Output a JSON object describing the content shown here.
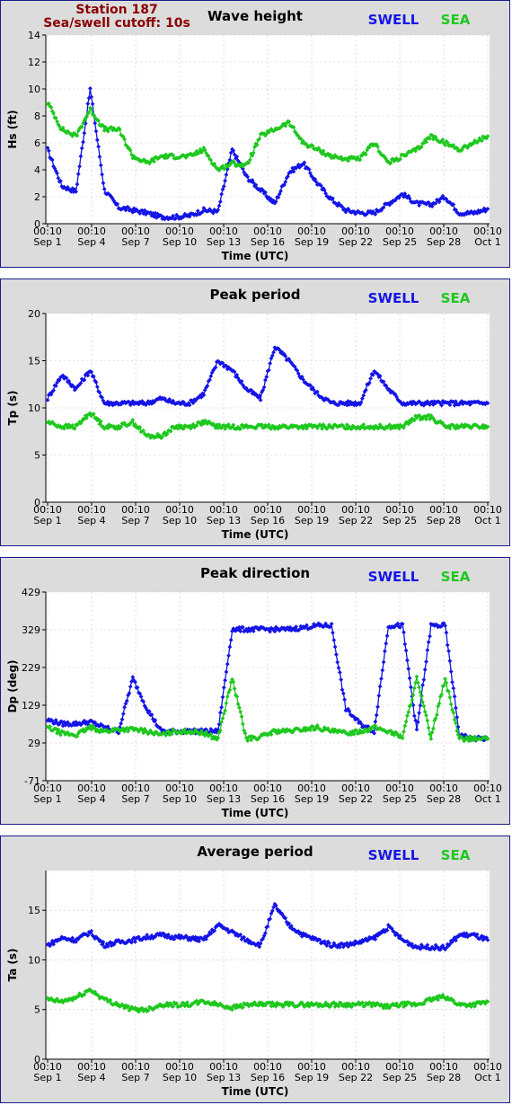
{
  "station": {
    "name": "Station 187",
    "cutoff": "Sea/swell cutoff: 10s"
  },
  "colors": {
    "swell": "#1414e6",
    "sea": "#1ec81e",
    "frame": "#1a1a8c",
    "panel_bg": "#dcdcdc",
    "plot_bg": "#ffffff",
    "station_text": "#8b0000"
  },
  "legend": {
    "swell": "SWELL",
    "sea": "SEA"
  },
  "x_axis": {
    "label": "Time (UTC)",
    "ticks": [
      {
        "time": "00:10",
        "date": "Sep 1"
      },
      {
        "time": "00:10",
        "date": "Sep 4"
      },
      {
        "time": "00:10",
        "date": "Sep 7"
      },
      {
        "time": "00:10",
        "date": "Sep 10"
      },
      {
        "time": "00:10",
        "date": "Sep 13"
      },
      {
        "time": "00:10",
        "date": "Sep 16"
      },
      {
        "time": "00:10",
        "date": "Sep 19"
      },
      {
        "time": "00:10",
        "date": "Sep 22"
      },
      {
        "time": "00:10",
        "date": "Sep 25"
      },
      {
        "time": "00:10",
        "date": "Sep 28"
      },
      {
        "time": "00:10",
        "date": "Oct 1"
      }
    ]
  },
  "chart_data": [
    {
      "type": "line",
      "title": "Wave height",
      "ylabel": "Hs (ft)",
      "ylim": [
        0,
        14
      ],
      "yticks": [
        "0",
        "2",
        "4",
        "6",
        "8",
        "10",
        "12",
        "14"
      ],
      "x": [
        "Sep 1",
        "Sep 2",
        "Sep 3",
        "Sep 4",
        "Sep 5",
        "Sep 6",
        "Sep 7",
        "Sep 8",
        "Sep 9",
        "Sep 10",
        "Sep 11",
        "Sep 12",
        "Sep 13",
        "Sep 14",
        "Sep 15",
        "Sep 16",
        "Sep 17",
        "Sep 18",
        "Sep 19",
        "Sep 20",
        "Sep 21",
        "Sep 22",
        "Sep 23",
        "Sep 24",
        "Sep 25",
        "Sep 26",
        "Sep 27",
        "Sep 28",
        "Sep 29",
        "Sep 30",
        "Oct 1",
        "Oct 2"
      ],
      "series": [
        {
          "name": "SWELL",
          "values": [
            5.5,
            2.8,
            2.4,
            10.0,
            2.5,
            1.2,
            1.0,
            0.8,
            0.5,
            0.5,
            0.6,
            1.0,
            0.9,
            5.5,
            3.5,
            2.5,
            1.5,
            3.8,
            4.5,
            3.0,
            1.8,
            1.0,
            0.8,
            0.8,
            1.5,
            2.2,
            1.5,
            1.4,
            2.0,
            0.8,
            0.8,
            1.1
          ]
        },
        {
          "name": "SEA",
          "values": [
            9.0,
            7.0,
            6.5,
            8.5,
            7.0,
            7.0,
            5.0,
            4.5,
            5.0,
            5.0,
            5.0,
            5.5,
            4.0,
            4.5,
            4.3,
            6.5,
            7.0,
            7.5,
            6.0,
            5.5,
            5.0,
            4.8,
            4.8,
            6.0,
            4.5,
            5.0,
            5.5,
            6.5,
            6.0,
            5.5,
            6.0,
            6.5
          ]
        }
      ]
    },
    {
      "type": "line",
      "title": "Peak period",
      "ylabel": "Tp (s)",
      "ylim": [
        0,
        20
      ],
      "yticks": [
        "0",
        "5",
        "10",
        "15",
        "20"
      ],
      "x": [
        "Sep 1",
        "Sep 2",
        "Sep 3",
        "Sep 4",
        "Sep 5",
        "Sep 6",
        "Sep 7",
        "Sep 8",
        "Sep 9",
        "Sep 10",
        "Sep 11",
        "Sep 12",
        "Sep 13",
        "Sep 14",
        "Sep 15",
        "Sep 16",
        "Sep 17",
        "Sep 18",
        "Sep 19",
        "Sep 20",
        "Sep 21",
        "Sep 22",
        "Sep 23",
        "Sep 24",
        "Sep 25",
        "Sep 26",
        "Sep 27",
        "Sep 28",
        "Sep 29",
        "Sep 30",
        "Oct 1",
        "Oct 2"
      ],
      "series": [
        {
          "name": "SWELL",
          "values": [
            11,
            13.5,
            12,
            14,
            10.5,
            10.5,
            10.5,
            10.5,
            11,
            10.5,
            10.5,
            11.5,
            15,
            14,
            12,
            11,
            16.5,
            15,
            13,
            11.5,
            10.5,
            10.5,
            10.5,
            14,
            12,
            10.5,
            10.5,
            10.5,
            10.5,
            10.5,
            10.5,
            10.5
          ]
        },
        {
          "name": "SEA",
          "values": [
            8.5,
            8,
            8,
            9.5,
            8,
            8,
            8.5,
            7,
            7,
            8,
            8,
            8.5,
            8,
            8,
            8,
            8,
            8,
            8,
            8,
            8,
            8,
            8,
            8,
            8,
            8,
            8,
            9,
            9,
            8,
            8,
            8,
            8
          ]
        }
      ]
    },
    {
      "type": "line",
      "title": "Peak direction",
      "ylabel": "Dp (deg)",
      "ylim": [
        -71,
        429
      ],
      "yticks": [
        "-71",
        "29",
        "129",
        "229",
        "329",
        "429"
      ],
      "x": [
        "Sep 1",
        "Sep 2",
        "Sep 3",
        "Sep 4",
        "Sep 5",
        "Sep 6",
        "Sep 7",
        "Sep 8",
        "Sep 9",
        "Sep 10",
        "Sep 11",
        "Sep 12",
        "Sep 13",
        "Sep 14",
        "Sep 15",
        "Sep 16",
        "Sep 17",
        "Sep 18",
        "Sep 19",
        "Sep 20",
        "Sep 21",
        "Sep 22",
        "Sep 23",
        "Sep 24",
        "Sep 25",
        "Sep 26",
        "Sep 27",
        "Sep 28",
        "Sep 29",
        "Sep 30",
        "Oct 1",
        "Oct 2"
      ],
      "series": [
        {
          "name": "SWELL",
          "values": [
            90,
            80,
            80,
            85,
            70,
            60,
            200,
            120,
            60,
            60,
            60,
            60,
            60,
            330,
            330,
            330,
            330,
            330,
            335,
            340,
            340,
            120,
            80,
            60,
            340,
            340,
            60,
            340,
            340,
            50,
            40,
            40
          ]
        },
        {
          "name": "SEA",
          "values": [
            70,
            55,
            50,
            70,
            60,
            65,
            65,
            60,
            50,
            60,
            60,
            55,
            40,
            200,
            40,
            45,
            60,
            60,
            65,
            70,
            60,
            55,
            60,
            70,
            60,
            45,
            200,
            45,
            200,
            40,
            40,
            40
          ]
        }
      ]
    },
    {
      "type": "line",
      "title": "Average period",
      "ylabel": "Ta (s)",
      "ylim": [
        0,
        19
      ],
      "yticks": [
        "0",
        "5",
        "10",
        "15"
      ],
      "x": [
        "Sep 1",
        "Sep 2",
        "Sep 3",
        "Sep 4",
        "Sep 5",
        "Sep 6",
        "Sep 7",
        "Sep 8",
        "Sep 9",
        "Sep 10",
        "Sep 11",
        "Sep 12",
        "Sep 13",
        "Sep 14",
        "Sep 15",
        "Sep 16",
        "Sep 17",
        "Sep 18",
        "Sep 19",
        "Sep 20",
        "Sep 21",
        "Sep 22",
        "Sep 23",
        "Sep 24",
        "Sep 25",
        "Sep 26",
        "Sep 27",
        "Sep 28",
        "Sep 29",
        "Sep 30",
        "Oct 1",
        "Oct 2"
      ],
      "series": [
        {
          "name": "SWELL",
          "values": [
            11.5,
            12.2,
            12.0,
            12.8,
            11.5,
            11.8,
            12.0,
            12.3,
            12.5,
            12.3,
            12.2,
            12.0,
            13.5,
            12.8,
            12.0,
            11.5,
            15.5,
            13.5,
            12.5,
            12.0,
            11.5,
            11.5,
            11.8,
            12.2,
            13.3,
            12.0,
            11.3,
            11.3,
            11.2,
            12.5,
            12.5,
            12.0
          ]
        },
        {
          "name": "SEA",
          "values": [
            6.0,
            5.8,
            6.2,
            7.0,
            6.0,
            5.5,
            5.0,
            5.0,
            5.5,
            5.5,
            5.5,
            5.8,
            5.5,
            5.2,
            5.5,
            5.5,
            5.5,
            5.5,
            5.5,
            5.5,
            5.5,
            5.5,
            5.5,
            5.5,
            5.3,
            5.5,
            5.5,
            6.0,
            6.3,
            5.5,
            5.5,
            5.8
          ]
        }
      ]
    }
  ]
}
